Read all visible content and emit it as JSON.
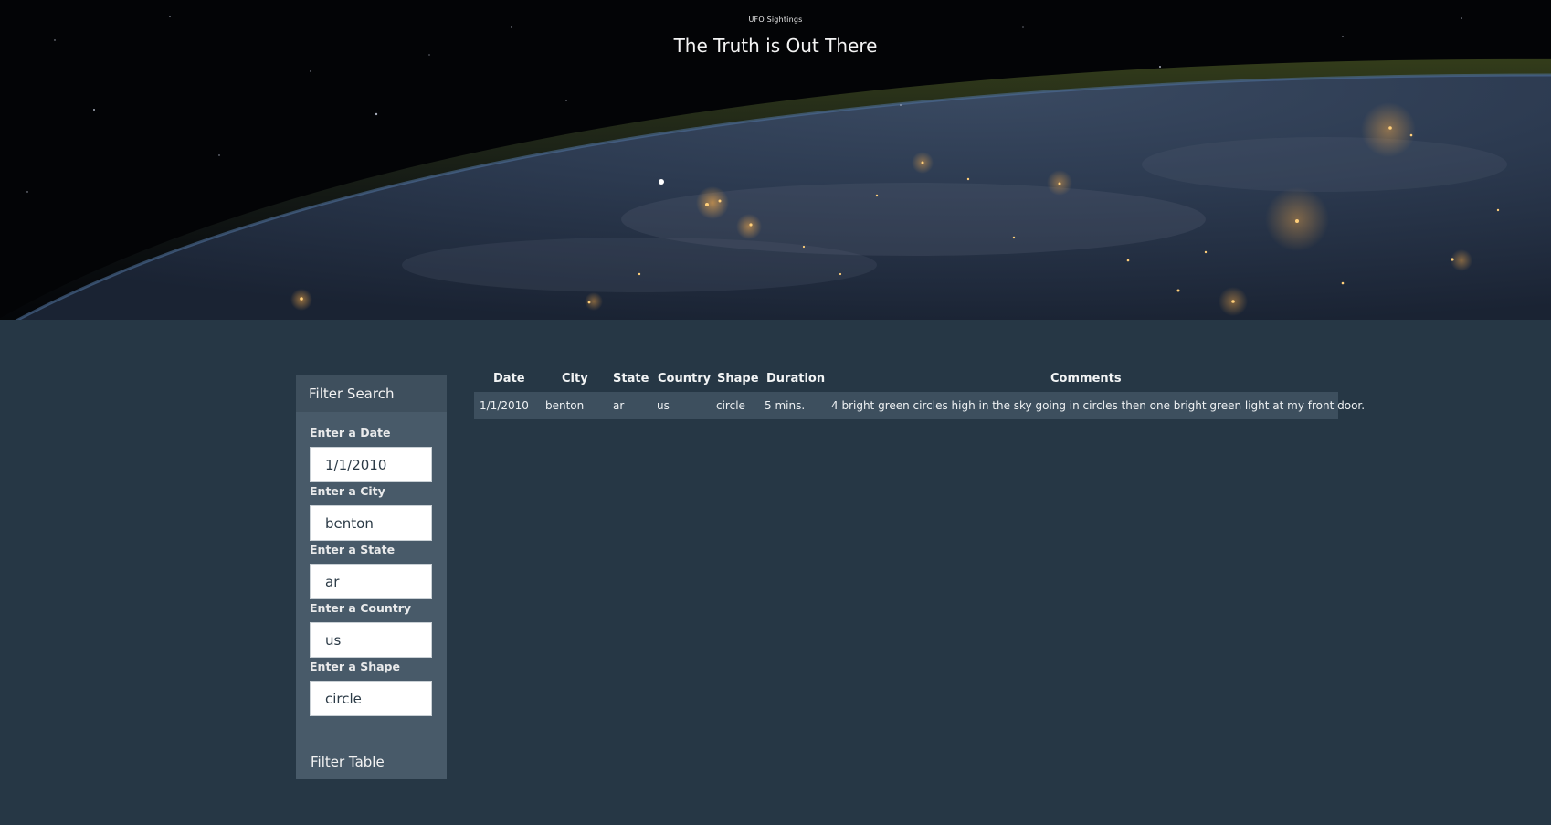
{
  "header": {
    "brand": "UFO Sightings",
    "title": "The Truth is Out There"
  },
  "filter": {
    "title": "Filter Search",
    "fields": [
      {
        "label": "Enter a Date",
        "value": "1/1/2010"
      },
      {
        "label": "Enter a City",
        "value": "benton"
      },
      {
        "label": "Enter a State",
        "value": "ar"
      },
      {
        "label": "Enter a Country",
        "value": "us"
      },
      {
        "label": "Enter a Shape",
        "value": "circle"
      }
    ],
    "button_label": "Filter Table"
  },
  "table": {
    "columns": [
      "Date",
      "City",
      "State",
      "Country",
      "Shape",
      "Duration",
      "Comments"
    ],
    "rows": [
      [
        "1/1/2010",
        "benton",
        "ar",
        "us",
        "circle",
        "5 mins.",
        "4 bright green circles high in the sky going in circles then one bright green light at my front door."
      ]
    ]
  },
  "colors": {
    "page_background": "#263745",
    "panel_background": "#485a69",
    "panel_header": "#3e4f5d",
    "row_background": "#3d4f5e"
  }
}
